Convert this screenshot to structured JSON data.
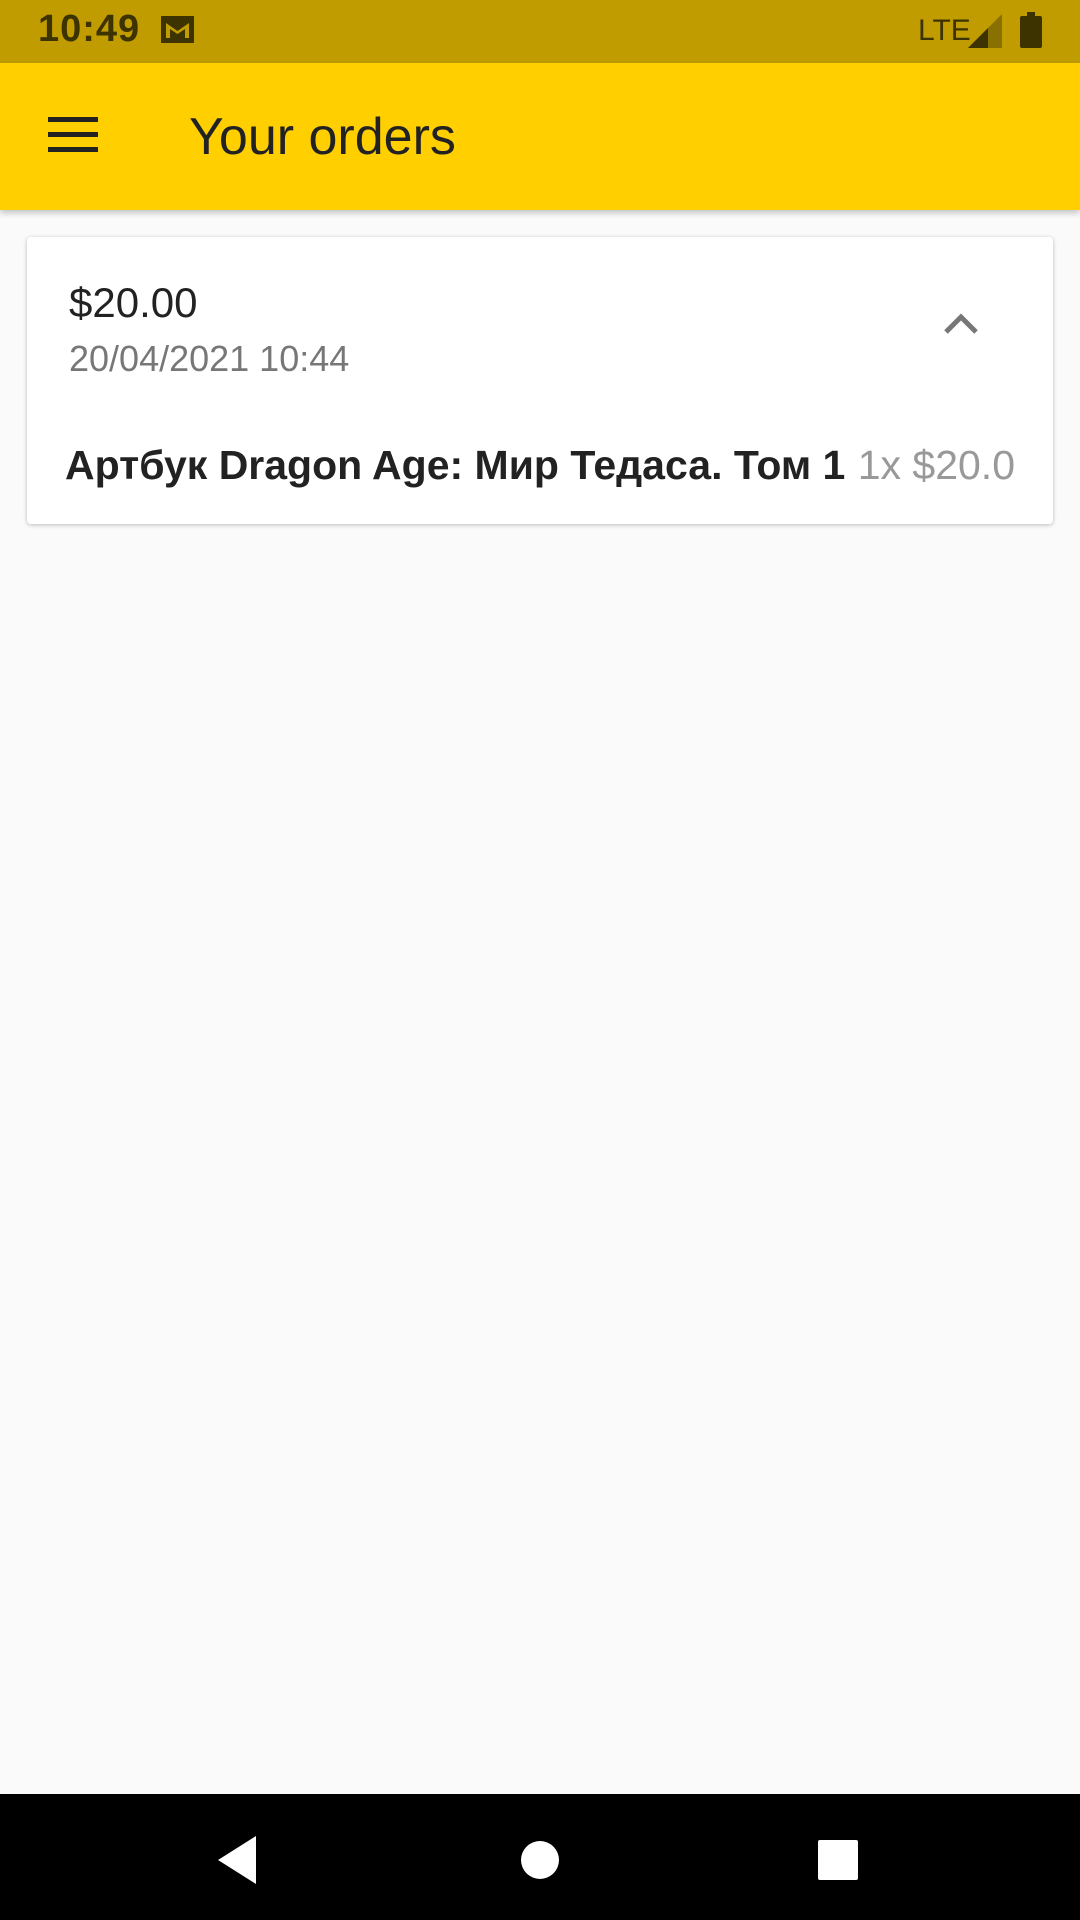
{
  "status_bar": {
    "time": "10:49",
    "network": "LTE",
    "icons": [
      "gmail-icon",
      "signal-icon",
      "battery-icon"
    ]
  },
  "app_bar": {
    "title": "Your orders",
    "menu_icon": "menu-icon",
    "color": "#ffcf00"
  },
  "orders": [
    {
      "total": "$20.00",
      "date": "20/04/2021 10:44",
      "expanded": true,
      "items": [
        {
          "name": "Артбук Dragon Age: Мир Тедаса. Том 1",
          "qty_price": "1x $20.0"
        }
      ]
    }
  ],
  "nav_bar": {
    "icons": [
      "back-icon",
      "home-icon",
      "recents-icon"
    ]
  }
}
